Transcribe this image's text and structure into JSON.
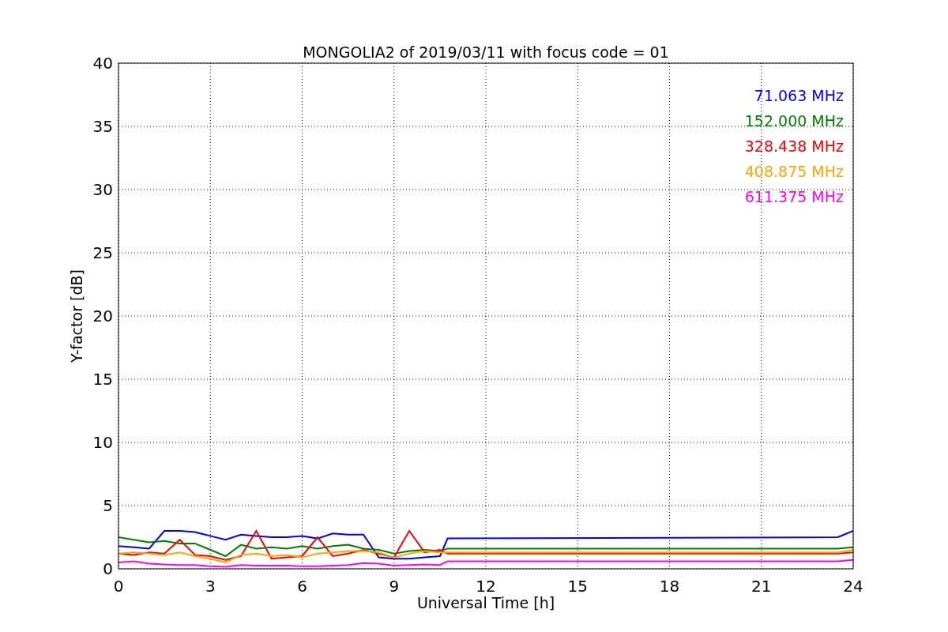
{
  "chart": {
    "chart_data": {
      "type": "line",
      "title": "MONGOLIA2 of 2019/03/11 with focus code = 01",
      "xlabel": "Universal Time [h]",
      "ylabel": "Y-factor [dB]",
      "x": [
        0,
        0.5,
        1,
        1.5,
        2,
        2.5,
        3,
        3.5,
        4,
        4.5,
        5,
        5.5,
        6,
        6.5,
        7,
        7.5,
        8,
        8.5,
        9,
        9.5,
        10,
        10.5,
        10.75,
        23.5,
        24
      ],
      "series": [
        {
          "name": "71.063 MHz",
          "color": "#0000ff",
          "values": [
            1.8,
            1.7,
            1.6,
            3.0,
            3.0,
            2.9,
            2.6,
            2.3,
            2.7,
            2.6,
            2.5,
            2.5,
            2.6,
            2.4,
            2.8,
            2.7,
            2.7,
            0.9,
            0.8,
            0.8,
            0.9,
            1.0,
            2.4,
            2.5,
            3.0
          ]
        },
        {
          "name": "152.000 MHz",
          "color": "#008000",
          "values": [
            2.5,
            2.3,
            2.1,
            2.2,
            2.0,
            2.0,
            1.5,
            1.0,
            1.9,
            1.6,
            1.7,
            1.6,
            1.8,
            1.6,
            1.8,
            1.9,
            1.6,
            1.5,
            1.2,
            1.4,
            1.5,
            1.4,
            1.6,
            1.6,
            1.7
          ]
        },
        {
          "name": "328.438 MHz",
          "color": "#ff0000",
          "values": [
            1.2,
            1.1,
            1.3,
            1.2,
            2.3,
            1.1,
            1.0,
            0.7,
            1.0,
            3.0,
            0.8,
            0.9,
            1.0,
            2.5,
            1.0,
            1.2,
            1.5,
            1.2,
            0.9,
            3.0,
            1.3,
            1.5,
            1.2,
            1.2,
            1.3
          ]
        },
        {
          "name": "408.875 MHz",
          "color": "#ffa500",
          "values": [
            1.2,
            1.3,
            1.2,
            1.1,
            1.3,
            1.0,
            0.8,
            0.5,
            1.1,
            1.2,
            1.0,
            1.1,
            0.9,
            1.2,
            1.3,
            1.4,
            1.4,
            1.3,
            0.9,
            1.2,
            1.4,
            1.3,
            1.3,
            1.3,
            1.5
          ]
        },
        {
          "name": "611.375 MHz",
          "color": "#ff00ff",
          "values": [
            0.5,
            0.6,
            0.4,
            0.35,
            0.3,
            0.3,
            0.2,
            0.15,
            0.3,
            0.25,
            0.25,
            0.25,
            0.2,
            0.2,
            0.25,
            0.3,
            0.45,
            0.4,
            0.25,
            0.3,
            0.35,
            0.3,
            0.6,
            0.6,
            0.7
          ]
        }
      ],
      "grid": true,
      "xlim": [
        0,
        24
      ],
      "ylim": [
        0,
        40
      ],
      "xticks": [
        0,
        3,
        6,
        9,
        12,
        15,
        18,
        21,
        24
      ],
      "yticks": [
        0,
        5,
        10,
        15,
        20,
        25,
        30,
        35,
        40
      ]
    }
  }
}
